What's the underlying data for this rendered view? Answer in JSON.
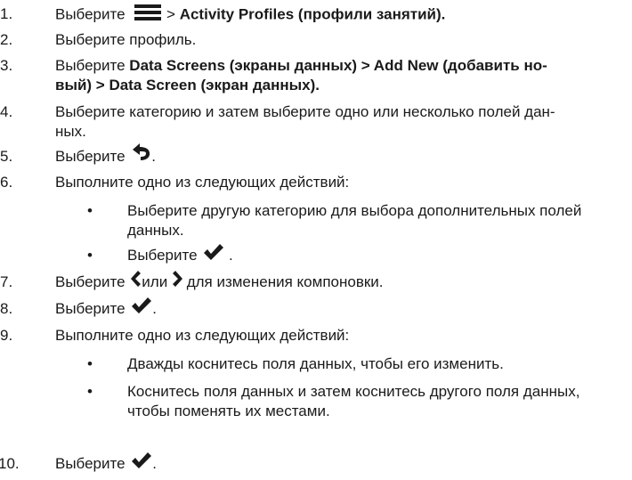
{
  "steps": [
    {
      "num": "1.",
      "pre": "Выберите",
      "sep": ">",
      "bold": "Activity Profiles (профили занятий).",
      "icon": "menu-icon"
    },
    {
      "num": "2.",
      "text": "Выберите профиль."
    },
    {
      "num": "3.",
      "pre": "Выберите",
      "bold_l1": "Data Screens (экраны данных) > Add New (добавить но-",
      "bold_l2": "вый) > Data Screen (экран данных)."
    },
    {
      "num": "4.",
      "l1": "Выберите категорию и затем выберите одно или несколько полей дан-",
      "l2": "ных."
    },
    {
      "num": "5.",
      "pre": "Выберите",
      "post": ".",
      "icon": "back-arrow-icon"
    },
    {
      "num": "6.",
      "text": "Выполните одно из следующих действий:"
    },
    {
      "bul": "•",
      "l1": "Выберите другую категорию для выбора дополнительных полей",
      "l2": "данных."
    },
    {
      "bul": "•",
      "pre": "Выберите",
      "post": ".",
      "icon": "checkmark-icon"
    },
    {
      "num": "7.",
      "pre": "Выберите",
      "mid": "или",
      "post": "для изменения компоновки.",
      "icon_l": "chevron-left-icon",
      "icon_r": "chevron-right-icon"
    },
    {
      "num": "8.",
      "pre": "Выберите",
      "post": ".",
      "icon": "checkmark-icon"
    },
    {
      "num": "9.",
      "text": "Выполните одно из следующих действий:"
    },
    {
      "bul": "•",
      "text": "Дважды коснитесь поля данных, чтобы его изменить."
    },
    {
      "bul": "•",
      "l1": "Коснитесь поля данных и затем коснитесь другого поля данных,",
      "l2": "чтобы поменять их местами."
    },
    {
      "num": "10.",
      "pre": "Выберите",
      "post": ".",
      "icon": "checkmark-icon"
    }
  ]
}
